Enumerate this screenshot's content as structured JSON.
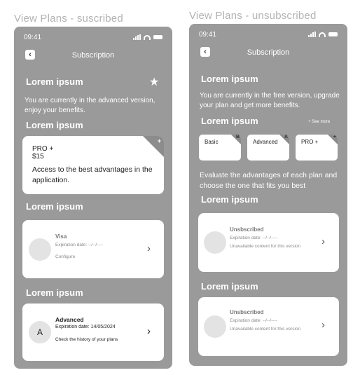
{
  "left_screen": {
    "frame_title": "View Plans - suscribed",
    "status_time": "09:41",
    "nav_title": "Subscription",
    "section1_title": "Lorem ipsum",
    "section1_text": "You are currently in the advanced version, enjoy your benefits.",
    "section2_title": "Lorem ipsum",
    "plan_card": {
      "name": "PRO +",
      "price": "$15",
      "description": "Access to the best advantages in the application.",
      "corner_badge": "+"
    },
    "section3_title": "Lorem ipsum",
    "payment_card": {
      "title": "Visa",
      "expiration": "Expiration date:  --/--/----",
      "action": "Configure"
    },
    "section4_title": "Lorem ipsum",
    "plan_history_card": {
      "avatar_letter": "A",
      "title": "Advanced",
      "expiration": "Expiration date:  14/05/2024",
      "action": "Check the history of your plans"
    }
  },
  "right_screen": {
    "frame_title": "View Plans - unsubscribed",
    "status_time": "09:41",
    "nav_title": "Subscription",
    "section1_title": "Lorem ipsum",
    "section1_text": "You are currently in the free version, upgrade your plan and get more benefits.",
    "section2_title": "Lorem ipsum",
    "see_more": "+ See more",
    "plans": [
      {
        "name": "Basic",
        "badge": "B"
      },
      {
        "name": "Advanced",
        "badge": "A"
      },
      {
        "name": "PRO +",
        "badge": "+"
      }
    ],
    "evaluate_text": "Evaluate the advantages of each plan and choose the one that fits you best",
    "section3_title": "Lorem ipsum",
    "card1": {
      "title": "Unsbscribed",
      "expiration": "Expiration date:  --/--/----",
      "note": "Unavailable content for this version"
    },
    "section4_title": "Lorem ipsum",
    "card2": {
      "title": "Unsbscribed",
      "expiration": "Expiration date:  --/--/----",
      "note": "Unavailable content for this version"
    }
  },
  "icons": [
    "back-arrow-icon",
    "star-icon",
    "chevron-right-icon",
    "signal-icon",
    "wifi-icon",
    "battery-icon"
  ]
}
